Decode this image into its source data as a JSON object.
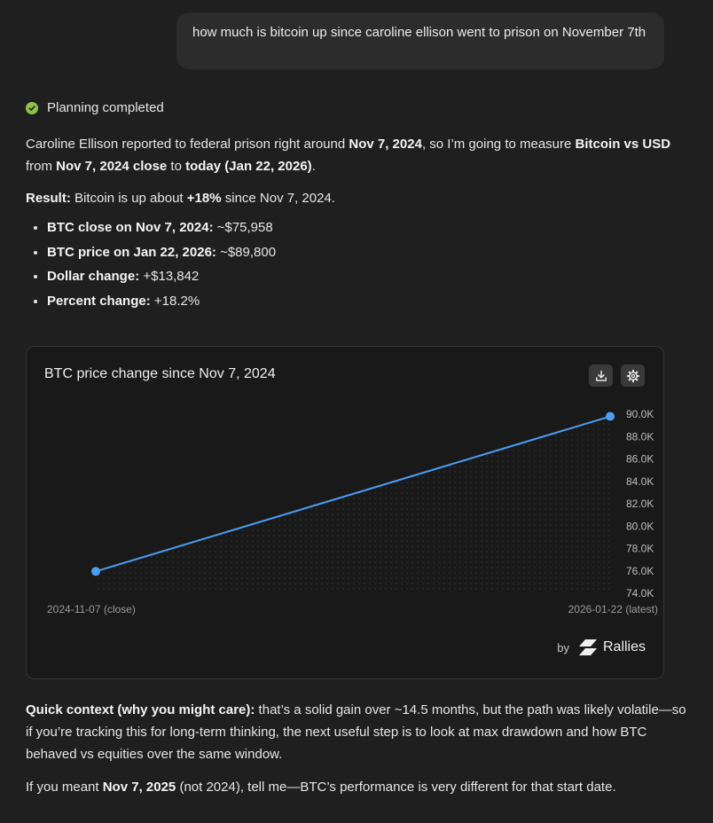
{
  "user_message": "how much is bitcoin up since caroline ellison went to prison on November 7th",
  "planning": {
    "label": "Planning completed"
  },
  "answer": {
    "p1": {
      "t1": "Caroline Ellison reported to federal prison right around ",
      "b1": "Nov 7, 2024",
      "t2": ", so I’m going to measure ",
      "b2": "Bitcoin vs USD",
      "t3": " from ",
      "b3": "Nov 7, 2024 close",
      "t4": " to ",
      "b4": "today (Jan 22, 2026)",
      "t5": "."
    },
    "result": {
      "label": "Result:",
      "t1": " Bitcoin is up about ",
      "b1": "+18%",
      "t2": " since Nov 7, 2024."
    },
    "stats": [
      {
        "label": "BTC close on Nov 7, 2024:",
        "value": " ~$75,958"
      },
      {
        "label": "BTC price on Jan 22, 2026:",
        "value": " ~$89,800"
      },
      {
        "label": "Dollar change:",
        "value": " +$13,842"
      },
      {
        "label": "Percent change:",
        "value": " +18.2%"
      }
    ]
  },
  "chart_card": {
    "title": "BTC price change since Nov 7, 2024",
    "download_icon": "download-icon",
    "settings_icon": "gear-icon",
    "by_label": "by",
    "brand": "Rallies",
    "brand_icon": "rallies-logo-icon"
  },
  "chart_data": {
    "type": "line",
    "title": "BTC price change since Nov 7, 2024",
    "x": [
      "2024-11-07",
      "2026-01-22"
    ],
    "x_tick_labels": [
      "2024-11-07 (close)",
      "2026-01-22 (latest)"
    ],
    "series": [
      {
        "values": [
          75958,
          89800
        ],
        "color": "#4a9ff5"
      }
    ],
    "y_ticks": [
      74000,
      76000,
      78000,
      80000,
      82000,
      84000,
      86000,
      88000,
      90000
    ],
    "y_tick_labels": [
      "74.0K",
      "76.0K",
      "78.0K",
      "80.0K",
      "82.0K",
      "84.0K",
      "86.0K",
      "88.0K",
      "90.0K"
    ],
    "ylim": [
      74000,
      90000
    ],
    "y_axis_side": "right",
    "grid": false,
    "fill": "dotted-area"
  },
  "context": {
    "p1_bold": "Quick context (why you might care):",
    "p1_text": " that’s a solid gain over ~14.5 months, but the path was likely volatile—so if you’re tracking this for long-term thinking, the next useful step is to look at max drawdown and how BTC behaved vs equities over the same window.",
    "p2_t1": "If you meant ",
    "p2_b1": "Nov 7, 2025",
    "p2_t2": " (not 2024), tell me—BTC’s performance is very different for that start date."
  },
  "colors": {
    "background": "#1f1f1f",
    "bubble": "#2c2c2c",
    "card": "#191919",
    "accent_line": "#4a9ff5",
    "check_green": "#8bc34a"
  }
}
